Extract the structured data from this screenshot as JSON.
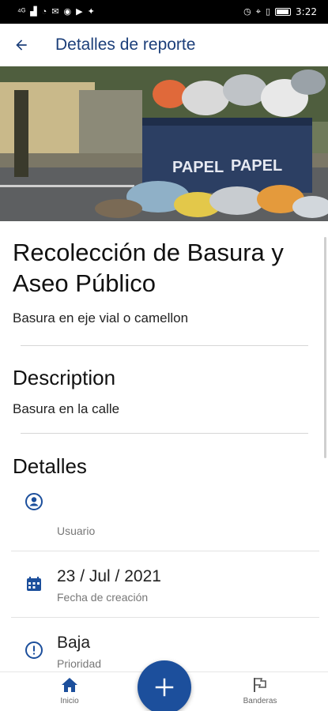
{
  "status_bar": {
    "time": "3:22",
    "left_icons": [
      "network-icon",
      "signal-icon",
      "wifi-icon",
      "app-icon",
      "app-icon",
      "youtube-icon",
      "twitter-icon"
    ],
    "right_icons": [
      "alarm-icon",
      "location-icon",
      "vibrate-icon",
      "battery-icon"
    ]
  },
  "app_bar": {
    "title": "Detalles de reporte",
    "back_icon": "arrow-back-icon"
  },
  "hero": {
    "container_text_1": "PAPEL",
    "container_text_2": "PAPEL"
  },
  "report": {
    "title": "Recolección de Basura y Aseo Público",
    "subtitle": "Basura en eje vial o camellon"
  },
  "description": {
    "heading": "Description",
    "text": "Basura en la calle"
  },
  "details": {
    "heading": "Detalles",
    "rows": [
      {
        "icon": "account-circle-icon",
        "value": "",
        "label": "Usuario"
      },
      {
        "icon": "calendar-icon",
        "value": "23 / Jul / 2021",
        "label": "Fecha de creación"
      },
      {
        "icon": "info-circle-icon",
        "value": "Baja",
        "label": "Prioridad"
      }
    ]
  },
  "bottom_nav": {
    "home_label": "Inicio",
    "flags_label": "Banderas",
    "fab_icon": "plus-icon"
  },
  "colors": {
    "primary": "#1c4f9c",
    "title_blue": "#1c3f7a",
    "status_bar": "#000000"
  }
}
